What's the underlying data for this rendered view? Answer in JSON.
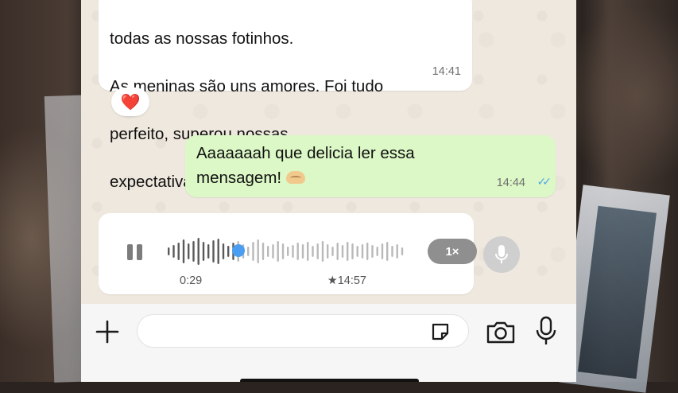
{
  "messages": [
    {
      "direction": "incoming",
      "lines": [
        "todas as nossas fotinhos.",
        "As meninas são uns amores. Foi tudo",
        "perfeito, superou nossas",
        "expectativas.  Muito legal Isa"
      ],
      "time": "14:41",
      "reaction": "❤️"
    },
    {
      "direction": "outgoing",
      "lines": [
        "Aaaaaaah que delicia ler essa",
        "mensagem!"
      ],
      "time": "14:44",
      "ticks": "✓✓",
      "status_color": "#4fa6e6"
    }
  ],
  "voice_message": {
    "duration": "0:29",
    "time": "★14:57",
    "speed": "1×",
    "progress": 0.3,
    "played_color": "#5a5a5a",
    "unplayed_color": "#b9b9b9",
    "scrubber_color": "#4a9df0",
    "bars": [
      10,
      16,
      22,
      30,
      20,
      26,
      34,
      24,
      18,
      28,
      32,
      20,
      14,
      22,
      26,
      18,
      12,
      24,
      30,
      22,
      14,
      18,
      26,
      20,
      12,
      16,
      22,
      18,
      24,
      14,
      20,
      26,
      18,
      12,
      22,
      16,
      24,
      20,
      14,
      18,
      22,
      16,
      12,
      20,
      24,
      14,
      18,
      10
    ]
  },
  "input": {
    "placeholder": ""
  },
  "colors": {
    "outgoing_bubble": "#dcf8c6",
    "incoming_bubble": "#ffffff",
    "chat_background": "#efe8de"
  }
}
